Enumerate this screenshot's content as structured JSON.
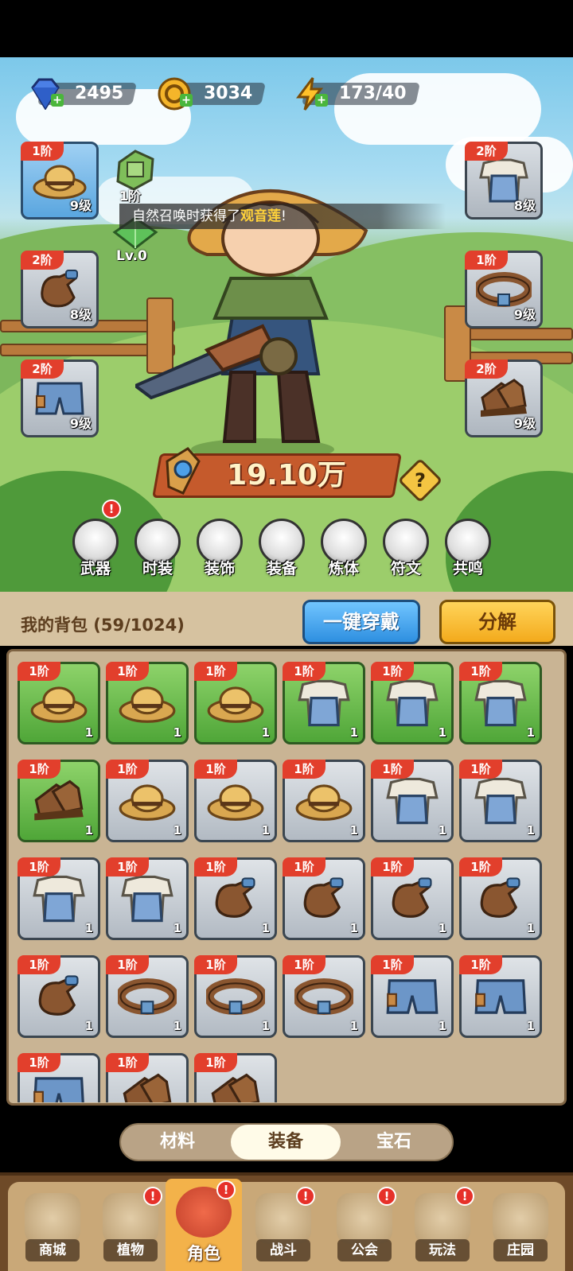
{
  "resources": {
    "gems": "2495",
    "coins": "3034",
    "energy": "173/40"
  },
  "colors": {
    "tier_badge": "#e23f2c",
    "green_slot": "#4fa638",
    "blue_button": "#2e8fe0",
    "yellow_button": "#f3aa1c",
    "highlight_text": "#ffd23a"
  },
  "left_slots": [
    {
      "tier": "1阶",
      "level": "9级",
      "item": "straw-hat-icon"
    },
    {
      "tier": "2阶",
      "level": "8级",
      "item": "glove-icon"
    },
    {
      "tier": "2阶",
      "level": "9级",
      "item": "shorts-icon"
    }
  ],
  "right_slots": [
    {
      "tier": "2阶",
      "level": "8级",
      "item": "overalls-shirt-icon"
    },
    {
      "tier": "1阶",
      "level": "9级",
      "item": "belt-icon"
    },
    {
      "tier": "2阶",
      "level": "9级",
      "item": "boots-icon"
    }
  ],
  "pet": {
    "tier": "1阶",
    "level": "Lv.0"
  },
  "notice": {
    "prefix": "自然召唤时获得了",
    "highlight": "观音莲",
    "suffix": "!"
  },
  "power": {
    "value": "19.10万",
    "help": "?"
  },
  "tabs": [
    {
      "label": "武器",
      "badge": "!"
    },
    {
      "label": "时装",
      "badge": ""
    },
    {
      "label": "装饰",
      "badge": ""
    },
    {
      "label": "装备",
      "badge": ""
    },
    {
      "label": "炼体",
      "badge": ""
    },
    {
      "label": "符文",
      "badge": ""
    },
    {
      "label": "共鸣",
      "badge": ""
    }
  ],
  "bag": {
    "title": "我的背包 (59/1024)",
    "equip_all": "一键穿戴",
    "decompose": "分解"
  },
  "inventory": [
    {
      "tier": "1阶",
      "count": "1",
      "item": "straw-hat-icon",
      "highlight": true
    },
    {
      "tier": "1阶",
      "count": "1",
      "item": "straw-hat-icon",
      "highlight": true
    },
    {
      "tier": "1阶",
      "count": "1",
      "item": "straw-hat-icon",
      "highlight": true
    },
    {
      "tier": "1阶",
      "count": "1",
      "item": "overalls-shirt-icon",
      "highlight": true
    },
    {
      "tier": "1阶",
      "count": "1",
      "item": "overalls-shirt-icon",
      "highlight": true
    },
    {
      "tier": "1阶",
      "count": "1",
      "item": "overalls-shirt-icon",
      "highlight": true
    },
    {
      "tier": "1阶",
      "count": "1",
      "item": "boots-icon",
      "highlight": true
    },
    {
      "tier": "1阶",
      "count": "1",
      "item": "straw-hat-icon",
      "highlight": false
    },
    {
      "tier": "1阶",
      "count": "1",
      "item": "straw-hat-icon",
      "highlight": false
    },
    {
      "tier": "1阶",
      "count": "1",
      "item": "straw-hat-icon",
      "highlight": false
    },
    {
      "tier": "1阶",
      "count": "1",
      "item": "overalls-shirt-icon",
      "highlight": false
    },
    {
      "tier": "1阶",
      "count": "1",
      "item": "overalls-shirt-icon",
      "highlight": false
    },
    {
      "tier": "1阶",
      "count": "1",
      "item": "overalls-shirt-icon",
      "highlight": false
    },
    {
      "tier": "1阶",
      "count": "1",
      "item": "overalls-shirt-icon",
      "highlight": false
    },
    {
      "tier": "1阶",
      "count": "1",
      "item": "glove-icon",
      "highlight": false
    },
    {
      "tier": "1阶",
      "count": "1",
      "item": "glove-icon",
      "highlight": false
    },
    {
      "tier": "1阶",
      "count": "1",
      "item": "glove-icon",
      "highlight": false
    },
    {
      "tier": "1阶",
      "count": "1",
      "item": "glove-icon",
      "highlight": false
    },
    {
      "tier": "1阶",
      "count": "1",
      "item": "glove-icon",
      "highlight": false
    },
    {
      "tier": "1阶",
      "count": "1",
      "item": "belt-icon",
      "highlight": false
    },
    {
      "tier": "1阶",
      "count": "1",
      "item": "belt-icon",
      "highlight": false
    },
    {
      "tier": "1阶",
      "count": "1",
      "item": "belt-icon",
      "highlight": false
    },
    {
      "tier": "1阶",
      "count": "1",
      "item": "shorts-icon",
      "highlight": false
    },
    {
      "tier": "1阶",
      "count": "1",
      "item": "shorts-icon",
      "highlight": false
    },
    {
      "tier": "1阶",
      "count": "",
      "item": "shorts-icon",
      "highlight": false
    },
    {
      "tier": "1阶",
      "count": "",
      "item": "boots-icon",
      "highlight": false
    },
    {
      "tier": "1阶",
      "count": "",
      "item": "boots-icon",
      "highlight": false
    }
  ],
  "segments": [
    {
      "label": "材料",
      "active": false
    },
    {
      "label": "装备",
      "active": true
    },
    {
      "label": "宝石",
      "active": false
    }
  ],
  "nav": [
    {
      "label": "商城",
      "icon": "shop-icon",
      "badge": "",
      "active": false
    },
    {
      "label": "植物",
      "icon": "plant-icon",
      "badge": "!",
      "active": false
    },
    {
      "label": "角色",
      "icon": "character-icon",
      "badge": "!",
      "active": true
    },
    {
      "label": "战斗",
      "icon": "battle-icon",
      "badge": "!",
      "active": false
    },
    {
      "label": "公会",
      "icon": "guild-icon",
      "badge": "!",
      "active": false
    },
    {
      "label": "玩法",
      "icon": "gameplay-icon",
      "badge": "!",
      "active": false
    },
    {
      "label": "庄园",
      "icon": "lock-icon",
      "badge": "",
      "active": false
    }
  ]
}
